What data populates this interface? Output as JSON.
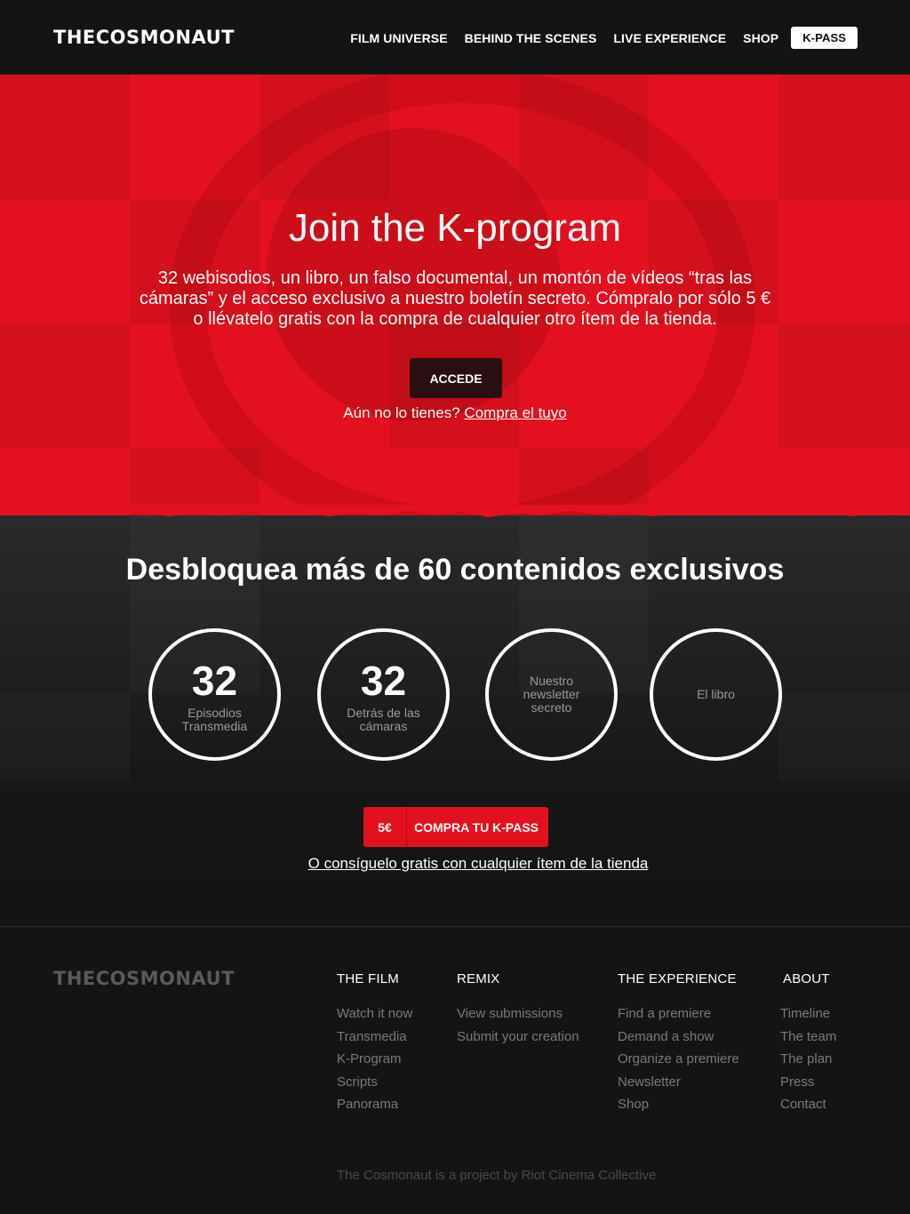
{
  "header": {
    "logo": "THECOSMONAUT",
    "nav": [
      "FILM UNIVERSE",
      "BEHIND THE SCENES",
      "LIVE EXPERIENCE",
      "SHOP"
    ],
    "kpass": "K-PASS"
  },
  "hero": {
    "title": "Join the K-program",
    "text_line1": "32 webisodios, un libro, un falso documental, un montón de vídeos “tras las",
    "text_line2": "cámaras” y el acceso exclusivo a nuestro boletín secreto. Cómpralo por sólo 5 €",
    "text_line3": "o llévatelo gratis con la compra de cualquier otro ítem de la tienda.",
    "button": "ACCEDE",
    "sub_prefix": "Aún no lo tienes?",
    "sub_link": "Compra el tuyo"
  },
  "unlock": {
    "title": "Desbloquea más de 60 contenidos exclusivos",
    "items": [
      {
        "number": "32",
        "label": "Episodios Transmedia"
      },
      {
        "number": "32",
        "label": "Detrás de las cámaras"
      },
      {
        "number": "",
        "label": "Nuestro newsletter secreto"
      },
      {
        "number": "",
        "label": "El libro"
      }
    ],
    "buy_price": "5€",
    "buy_label": "COMPRA TU K-PASS",
    "free_link": "O consíguelo gratis con cualquier ítem de la tienda"
  },
  "footer": {
    "logo": "THECOSMONAUT",
    "columns": [
      {
        "heading": "THE FILM",
        "links": [
          "Watch it now",
          "Transmedia",
          "K-Program",
          "Scripts",
          "Panorama"
        ]
      },
      {
        "heading": "REMIX",
        "links": [
          "View submissions",
          "Submit your creation"
        ]
      },
      {
        "heading": "THE EXPERIENCE",
        "links": [
          "Find a premiere",
          "Demand a show",
          "Organize a premiere",
          "Newsletter",
          "Shop"
        ]
      },
      {
        "heading": "ABOUT",
        "links": [
          "Timeline",
          "The team",
          "The plan",
          "Press",
          "Contact"
        ]
      }
    ],
    "credit": "The Cosmonaut is a project by Riot Cinema Collective"
  },
  "colors": {
    "accent": "#e3111f",
    "background": "#141414",
    "muted": "#7a7a7a"
  }
}
